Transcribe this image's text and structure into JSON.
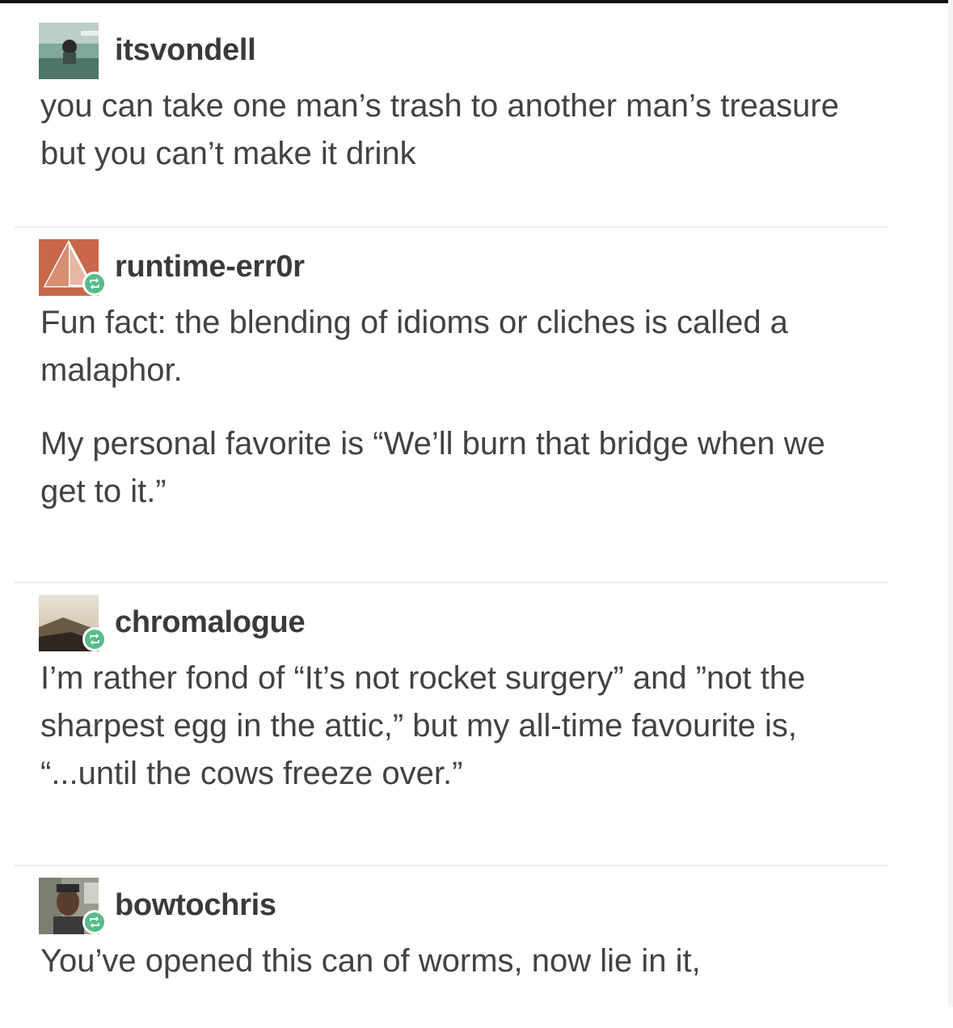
{
  "posts": [
    {
      "username": "itsvondell",
      "avatar_icon": "user-avatar-photo-icon",
      "reblogged": false,
      "paragraphs": [
        "you can take one man’s trash to another man’s treasure but you can’t make it drink"
      ]
    },
    {
      "username": "runtime-err0r",
      "avatar_icon": "pyramid-avatar-icon",
      "reblogged": true,
      "paragraphs": [
        "Fun fact: the blending of idioms or cliches is called a malaphor.",
        "My personal favorite is “We’ll burn that bridge when we get to it.”"
      ]
    },
    {
      "username": "chromalogue",
      "avatar_icon": "landscape-avatar-icon",
      "reblogged": true,
      "paragraphs": [
        "I’m rather fond of “It’s not rocket surgery” and ”not the sharpest egg in the attic,” but my all-time favourite is, “...until the cows freeze over.”"
      ]
    },
    {
      "username": "bowtochris",
      "avatar_icon": "user-avatar-photo-icon",
      "reblogged": true,
      "paragraphs": [
        "You’ve opened this can of worms, now lie in it,"
      ]
    }
  ],
  "colors": {
    "reblog_badge": "#56bc8a",
    "divider": "#ececec",
    "text": "#424242"
  }
}
